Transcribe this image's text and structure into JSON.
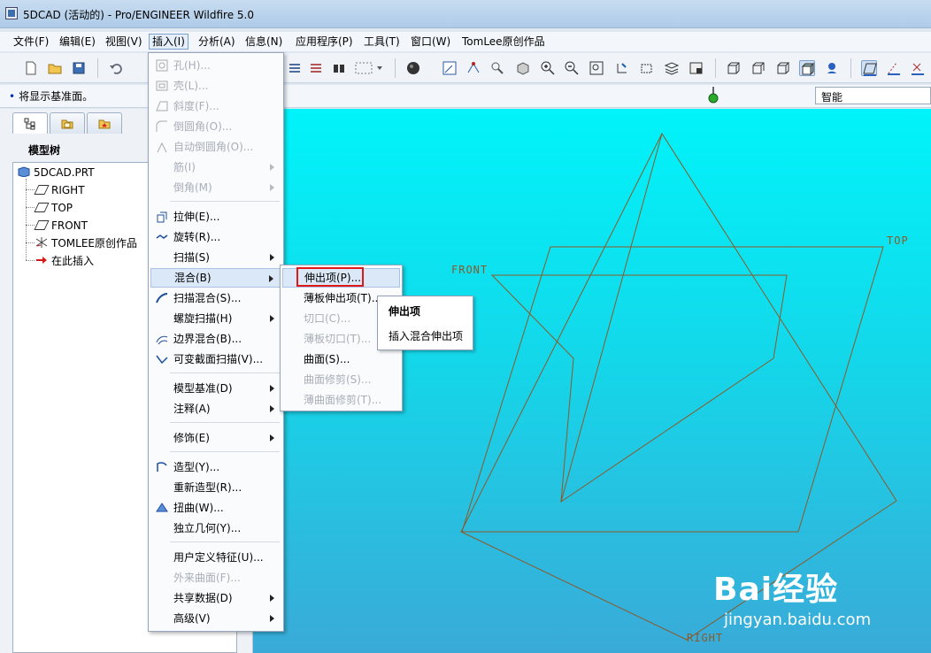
{
  "window": {
    "title": "5DCAD (活动的) - Pro/ENGINEER Wildfire 5.0"
  },
  "menubar": {
    "items": [
      "文件(F)",
      "编辑(E)",
      "视图(V)",
      "插入(I)",
      "分析(A)",
      "信息(N)",
      "应用程序(P)",
      "工具(T)",
      "窗口(W)",
      "TomLee原创作品"
    ]
  },
  "status": {
    "message": "将显示基准面。",
    "filter_value": "智能"
  },
  "model_tree": {
    "title": "模型树",
    "items": [
      "5DCAD.PRT",
      "RIGHT",
      "TOP",
      "FRONT",
      "TOMLEE原创作品",
      "在此插入"
    ]
  },
  "insert_menu": {
    "items": [
      {
        "label": "孔(H)...",
        "disabled": true
      },
      {
        "label": "壳(L)...",
        "disabled": true
      },
      {
        "label": "斜度(F)...",
        "disabled": true
      },
      {
        "label": "倒圆角(O)...",
        "disabled": true
      },
      {
        "label": "自动倒圆角(O)...",
        "disabled": true
      },
      {
        "label": "筋(I)",
        "disabled": true
      },
      {
        "label": "倒角(M)",
        "disabled": true
      },
      {
        "label": "拉伸(E)...",
        "disabled": false
      },
      {
        "label": "旋转(R)...",
        "disabled": false
      },
      {
        "label": "扫描(S)",
        "disabled": false
      },
      {
        "label": "混合(B)",
        "disabled": false
      },
      {
        "label": "扫描混合(S)...",
        "disabled": false
      },
      {
        "label": "螺旋扫描(H)",
        "disabled": false
      },
      {
        "label": "边界混合(B)...",
        "disabled": false
      },
      {
        "label": "可变截面扫描(V)...",
        "disabled": false
      },
      {
        "label": "模型基准(D)",
        "disabled": false
      },
      {
        "label": "注释(A)",
        "disabled": false
      },
      {
        "label": "修饰(E)",
        "disabled": false
      },
      {
        "label": "造型(Y)...",
        "disabled": false
      },
      {
        "label": "重新造型(R)...",
        "disabled": false
      },
      {
        "label": "扭曲(W)...",
        "disabled": false
      },
      {
        "label": "独立几何(Y)...",
        "disabled": false
      },
      {
        "label": "用户定义特征(U)...",
        "disabled": false
      },
      {
        "label": "外来曲面(F)...",
        "disabled": true
      },
      {
        "label": "共享数据(D)",
        "disabled": false
      },
      {
        "label": "高级(V)",
        "disabled": false
      }
    ]
  },
  "blend_submenu": {
    "items": [
      {
        "label": "伸出项(P)...",
        "disabled": false
      },
      {
        "label": "薄板伸出项(T)...",
        "disabled": false
      },
      {
        "label": "切口(C)...",
        "disabled": true
      },
      {
        "label": "薄板切口(T)...",
        "disabled": true
      },
      {
        "label": "曲面(S)...",
        "disabled": false
      },
      {
        "label": "曲面修剪(S)...",
        "disabled": true
      },
      {
        "label": "薄曲面修剪(T)...",
        "disabled": true
      }
    ]
  },
  "tooltip": {
    "title": "伸出项",
    "description": "插入混合伸出项"
  },
  "viewport": {
    "labels": {
      "front": "FRONT",
      "top": "TOP",
      "right": "RIGHT"
    }
  },
  "watermark": {
    "brand": "Bai经验",
    "url": "jingyan.baidu.com"
  },
  "colors": {
    "viewport_top": "#00f4fa",
    "viewport_bottom": "#3aaad8",
    "datum": "#8a5a2a",
    "highlight": "#e01818"
  }
}
